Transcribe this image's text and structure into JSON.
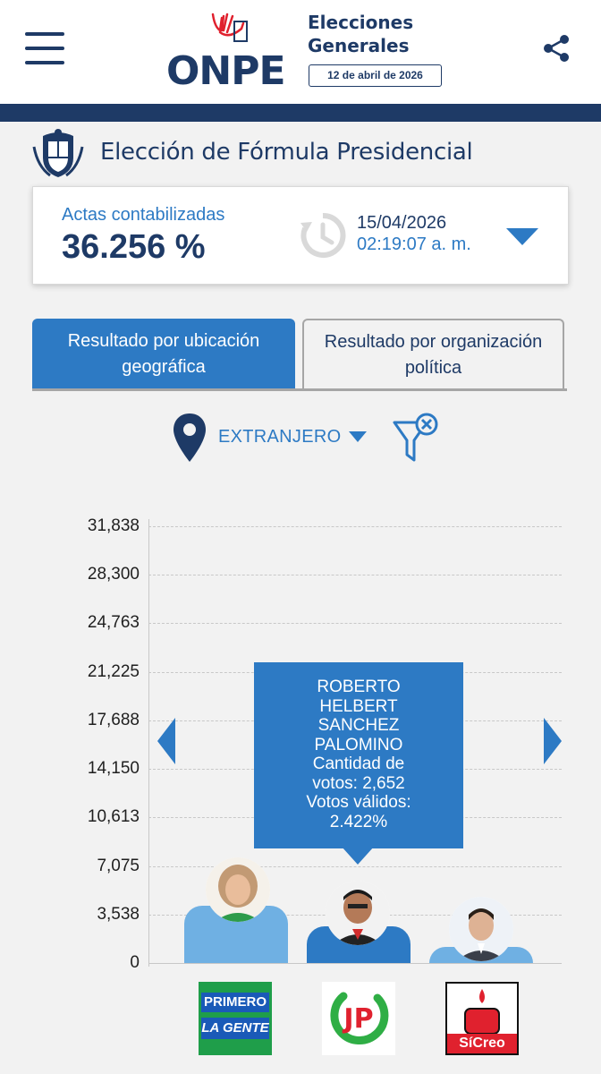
{
  "header": {
    "logo_text": "ONPE",
    "title_line1": "Elecciones",
    "title_line2": "Generales",
    "date": "12 de abril de 2026",
    "menu_icon": "hamburger-menu-icon",
    "share_icon": "share-icon"
  },
  "page": {
    "title": "Elección de Fórmula Presidencial",
    "emblem_icon": "peru-coat-of-arms-icon"
  },
  "actas": {
    "label": "Actas contabilizadas",
    "value": "36.256 %",
    "date": "15/04/2026",
    "time": "02:19:07 a. m.",
    "clock_icon": "history-clock-icon",
    "toggle_icon": "caret-down-icon"
  },
  "tabs": [
    {
      "label": "Resultado por ubicación geográfica",
      "active": true
    },
    {
      "label": "Resultado por organización política",
      "active": false
    }
  ],
  "location": {
    "selected": "EXTRANJERO",
    "pin_icon": "location-pin-icon",
    "clear_filter_icon": "clear-filter-icon"
  },
  "colors": {
    "navy": "#1e3a66",
    "blue": "#2d7ac4",
    "light_bar": "#6fb0e3"
  },
  "chart_data": {
    "type": "bar",
    "yticks": [
      "31,838",
      "28,300",
      "24,763",
      "21,225",
      "17,688",
      "14,150",
      "10,613",
      "7,075",
      "3,538",
      "0"
    ],
    "ylim": [
      0,
      31838
    ],
    "grid": true,
    "values": [
      4200,
      2652,
      1150
    ],
    "highlighted_index": 1,
    "tooltip": {
      "line1": "ROBERTO",
      "line2": "HELBERT",
      "line3": "SANCHEZ",
      "line4": "PALOMINO",
      "line5": "Cantidad de",
      "line6": "votos: 2,652",
      "line7": "Votos válidos:",
      "line8": "2.422%"
    },
    "party_logos": [
      {
        "line1": "PRIMERO",
        "line2": "LA GENTE"
      },
      {
        "text": "JP"
      },
      {
        "text": "SíCreo"
      }
    ],
    "prev_icon": "chevron-left-icon",
    "next_icon": "chevron-right-icon"
  }
}
